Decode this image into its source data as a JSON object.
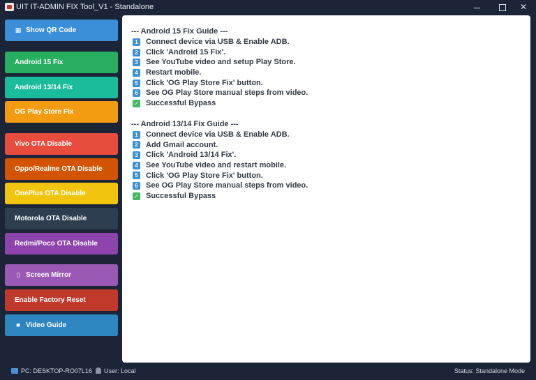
{
  "window": {
    "title": "UIT IT-ADMIN FIX Tool_V1 - Standalone",
    "minimize_glyph": "",
    "maximize_glyph": "",
    "close_glyph": "✕"
  },
  "sidebar": {
    "items": [
      {
        "label": "Show QR Code",
        "icon": "qr-code-icon",
        "glyph": "▦",
        "color": "#3b8ed8"
      },
      {
        "label": "Android 15 Fix",
        "color": "#27ae60"
      },
      {
        "label": "Android 13/14 Fix",
        "color": "#1abc9c"
      },
      {
        "label": "OG Play Store Fix",
        "color": "#f39c12"
      },
      {
        "label": "Vivo OTA Disable",
        "color": "#e74c3c"
      },
      {
        "label": "Oppo/Realme OTA Disable",
        "color": "#d35400"
      },
      {
        "label": "OnePlus OTA Disable",
        "color": "#f1c40f"
      },
      {
        "label": "Motorola OTA Disable",
        "color": "#2c3e50"
      },
      {
        "label": "Redmi/Poco OTA Disable",
        "color": "#8e44ad"
      },
      {
        "label": "Screen Mirror",
        "icon": "phone-icon",
        "glyph": "▯",
        "color": "#9b59b6"
      },
      {
        "label": "Enable Factory Reset",
        "color": "#c0392b"
      },
      {
        "label": "Video Guide",
        "icon": "video-icon",
        "glyph": "■",
        "color": "#2e86c1"
      }
    ]
  },
  "guides": [
    {
      "heading": "--- Android 15 Fix Guide ---",
      "steps": [
        {
          "badge": "1",
          "text": "Connect device via USB & Enable ADB."
        },
        {
          "badge": "2",
          "text": "Click 'Android 15 Fix'."
        },
        {
          "badge": "3",
          "text": "See YouTube video and setup Play Store."
        },
        {
          "badge": "4",
          "text": "Restart mobile."
        },
        {
          "badge": "5",
          "text": "Click 'OG Play Store Fix' button."
        },
        {
          "badge": "6",
          "text": "See OG Play Store manual steps from video."
        },
        {
          "badge": "✓",
          "text": "Successful Bypass"
        }
      ]
    },
    {
      "heading": "--- Android 13/14 Fix Guide ---",
      "steps": [
        {
          "badge": "1",
          "text": "Connect device via USB & Enable ADB."
        },
        {
          "badge": "2",
          "text": "Add Gmail account."
        },
        {
          "badge": "3",
          "text": "Click 'Android 13/14 Fix'."
        },
        {
          "badge": "4",
          "text": "See YouTube video and restart mobile."
        },
        {
          "badge": "5",
          "text": "Click 'OG Play Store Fix' button."
        },
        {
          "badge": "6",
          "text": "See OG Play Store manual steps from video."
        },
        {
          "badge": "✓",
          "text": "Successful Bypass"
        }
      ]
    }
  ],
  "statusbar": {
    "pc": "PC: DESKTOP-RO07L16",
    "user": "User: Local",
    "status": "Status: Standalone Mode"
  }
}
